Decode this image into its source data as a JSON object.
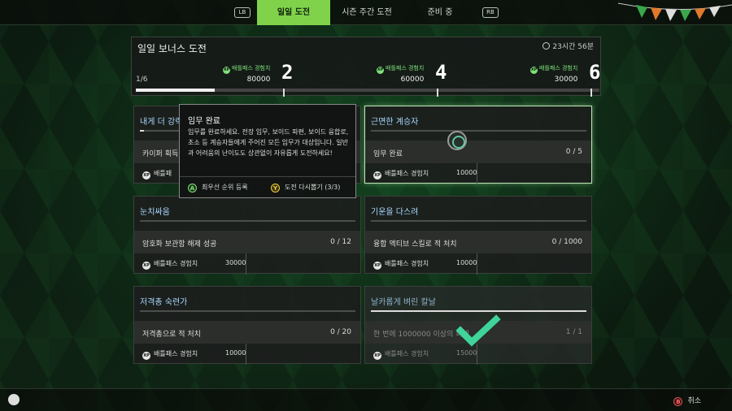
{
  "nav": {
    "lb": "LB",
    "rb": "RB",
    "tabs": [
      {
        "label": "일일 도전",
        "active": true
      },
      {
        "label": "시즌 주간 도전",
        "active": false
      },
      {
        "label": "준비 중",
        "active": false
      }
    ]
  },
  "header": {
    "title": "일일 보너스 도전",
    "timer": "23시간 56분",
    "progress_label": "1/6",
    "progress_fraction": 0.17,
    "rewards": [
      {
        "label": "배틀패스 경험치",
        "value": "80000",
        "milestone": "2"
      },
      {
        "label": "배틀패스 경험치",
        "value": "60000",
        "milestone": "4"
      },
      {
        "label": "배틀패스 경험치",
        "value": "30000",
        "milestone": "6"
      }
    ]
  },
  "cards": [
    {
      "title": "내게 더 강력",
      "task": "카이퍼 획득",
      "count": "",
      "reward_label": "배틀패",
      "reward_value": "",
      "progress": 0.02
    },
    {
      "title": "근면한 계승자",
      "task": "임무 완료",
      "count": "0 / 5",
      "reward_label": "배틀패스 경험치",
      "reward_value": "10000",
      "progress": 0
    },
    {
      "title": "눈치싸움",
      "task": "암호화 보관함 해제 성공",
      "count": "0 / 12",
      "reward_label": "배틀패스 경험치",
      "reward_value": "30000",
      "progress": 0
    },
    {
      "title": "기운을 다스려",
      "task": "융합 액티브 스킬로 적 처치",
      "count": "0 / 1000",
      "reward_label": "배틀패스 경험치",
      "reward_value": "10000",
      "progress": 0
    },
    {
      "title": "저격총 숙련가",
      "task": "저격총으로 적 처치",
      "count": "0 / 20",
      "reward_label": "배틀패스 경험치",
      "reward_value": "10000",
      "progress": 0
    },
    {
      "title": "날카롭게 벼린 칼날",
      "task": "한 번에 1000000 이상의 피해",
      "count": "1 / 1",
      "reward_label": "배틀패스 경험치",
      "reward_value": "15000",
      "progress": 1
    }
  ],
  "tooltip": {
    "title": "임무 완료",
    "body": "임무를 완료하세요. 전장 임무, 보이드 파편, 보이드 융합로, 초소 등 계승자들에게 주어진 모든 임무가 대상입니다. 일반과 어려움의 난이도도 상관없이 자유롭게 도전하세요!",
    "action_a_key": "A",
    "action_a": "최우선 순위 등록",
    "action_y_key": "Y",
    "action_y": "도전 다시뽑기 (3/3)"
  },
  "footer": {
    "cancel_key": "B",
    "cancel": "취소"
  },
  "colors": {
    "accent": "#7fd24a",
    "title_blue": "#a8d8ff",
    "check": "#3fd59a"
  }
}
